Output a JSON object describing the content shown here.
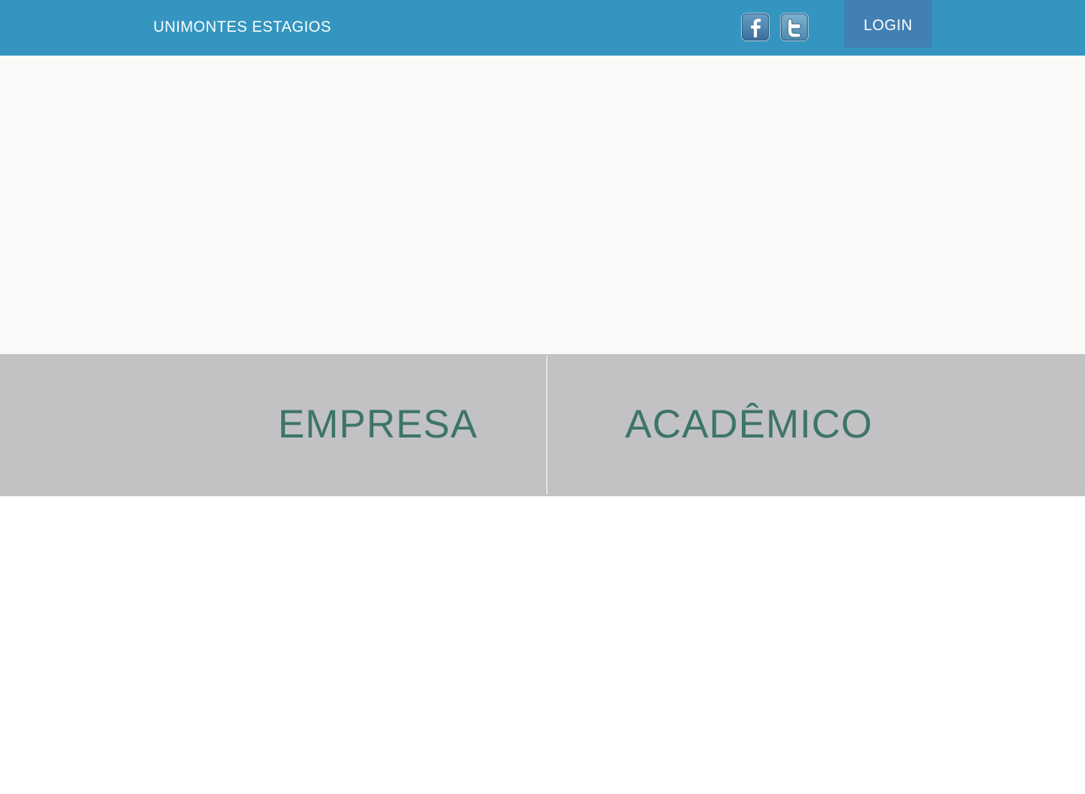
{
  "header": {
    "brand": "UNIMONTES ESTAGIOS",
    "social": [
      {
        "name": "facebook-icon"
      },
      {
        "name": "twitter-icon"
      }
    ],
    "login_label": "LOGIN"
  },
  "choices": {
    "empresa": "EMPRESA",
    "academico": "ACADÊMICO"
  },
  "colors": {
    "header_bg": "#3495c0",
    "login_bg": "#427fb3",
    "choice_bg": "#c2c2c4",
    "choice_text": "#3d7566",
    "hero_bg": "#fafaf8"
  }
}
